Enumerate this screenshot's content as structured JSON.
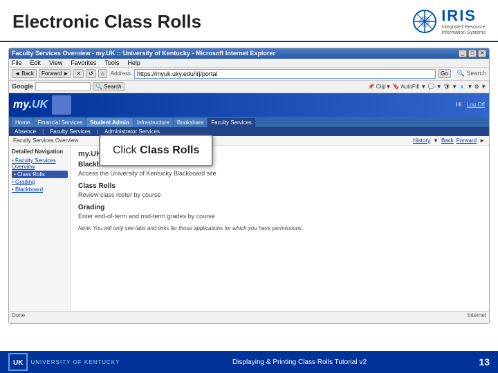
{
  "header": {
    "title": "Electronic Class Rolls",
    "iris_logo_text": "IRIS",
    "iris_logo_subtext": "Integrated\nResource\nInformation\nSystems"
  },
  "browser": {
    "title": "Faculty Services Overview - my.UK :: University of Kentucky - Microsoft Internet Explorer",
    "address": "https://myuk.uky.edu/irj/portal",
    "menu_items": [
      "File",
      "Edit",
      "View",
      "Favorites",
      "Tools",
      "Help"
    ],
    "back_btn": "←",
    "forward_btn": "→",
    "stop_btn": "✕",
    "refresh_btn": "↺",
    "home_btn": "⌂",
    "go_btn": "Go"
  },
  "myuk": {
    "logo": "my.UK",
    "logo_sub": "UK",
    "welcome": "Hi",
    "logout": "Log Off"
  },
  "nav_tabs": [
    {
      "label": "Home",
      "active": false
    },
    {
      "label": "Financial Services",
      "active": false
    },
    {
      "label": "Student Admin",
      "active": true
    },
    {
      "label": "Infrastructure",
      "active": false
    },
    {
      "label": "Bookshare",
      "active": false
    },
    {
      "label": "Faculty Services",
      "active": false
    }
  ],
  "sub_nav": [
    {
      "label": "Absence"
    },
    {
      "label": "Faculty Services"
    },
    {
      "label": "Administrator Services"
    }
  ],
  "breadcrumb": {
    "page_title": "Faculty Services Overview",
    "history": "History",
    "back": "Back",
    "forward": "Forward"
  },
  "left_nav": {
    "title": "Detailed Navigation",
    "items": [
      {
        "label": "Faculty Services Overview",
        "active": false
      },
      {
        "label": "Class Rolls",
        "active": true
      },
      {
        "label": "Grading",
        "active": false
      },
      {
        "label": "Blackboard",
        "active": false
      }
    ]
  },
  "main_content": {
    "title": "my.UK Faculty Services Overview",
    "sections": [
      {
        "heading": "Blackboard",
        "text": "Access the University of Kentucky Blackboard site"
      },
      {
        "heading": "Class Rolls",
        "text": "Review class roster by course"
      },
      {
        "heading": "Grading",
        "text": "Enter end-of-term and mid-term grades by course"
      }
    ],
    "note": "Note: You will only see tabs and links for those applications for which you have permissions."
  },
  "callout": {
    "text": "Click ",
    "bold_text": "Class Rolls"
  },
  "footer": {
    "uk_label": "UK",
    "university_name": "UNIVERSITY OF KENTUCKY",
    "tutorial_text": "Displaying & Printing Class Rolls Tutorial v2",
    "page_number": "13"
  },
  "status_bar": {
    "text": "Done",
    "right_text": "Internet"
  }
}
